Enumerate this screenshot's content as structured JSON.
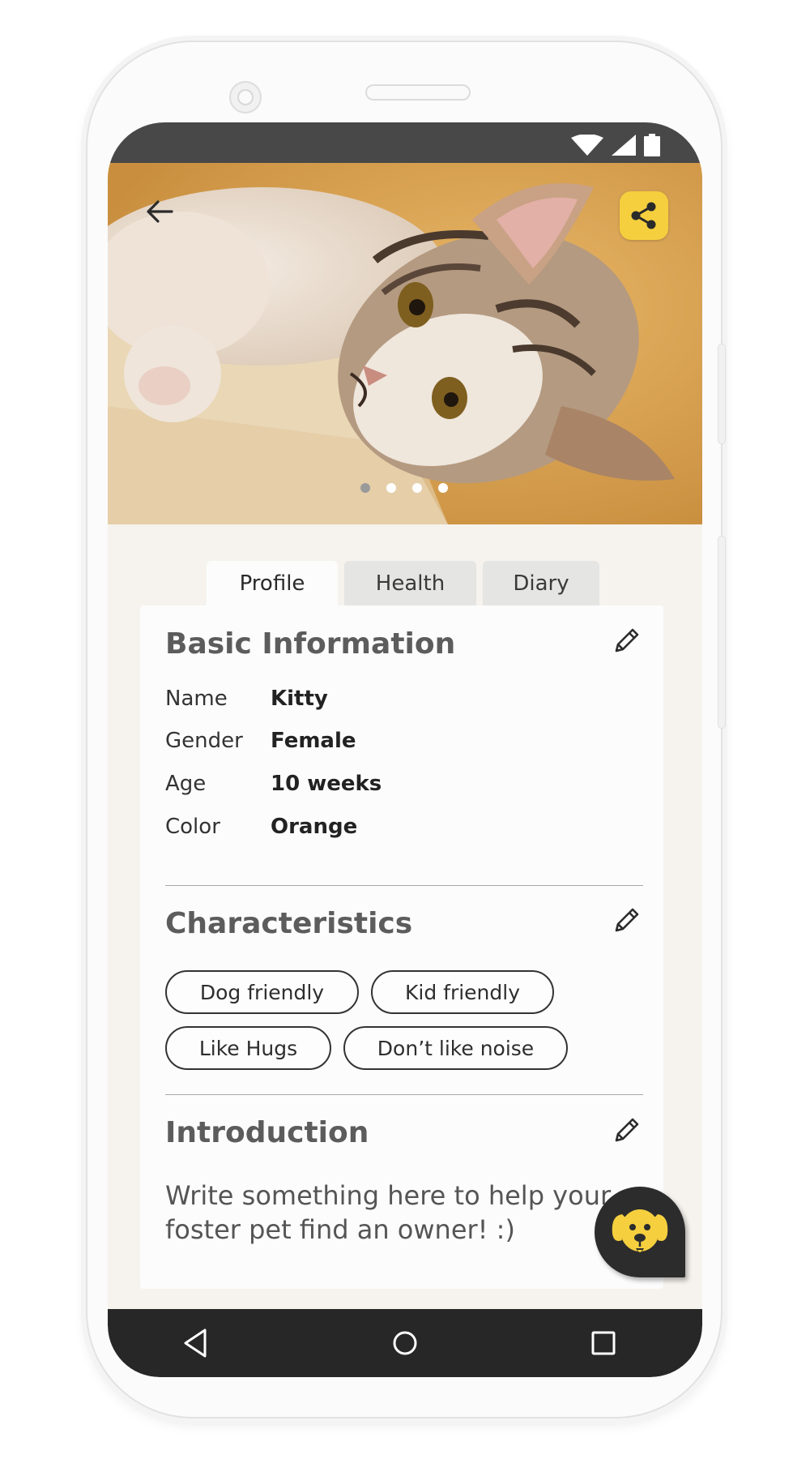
{
  "tabs": [
    {
      "label": "Profile",
      "active": true
    },
    {
      "label": "Health",
      "active": false
    },
    {
      "label": "Diary",
      "active": false
    }
  ],
  "basic_info": {
    "title": "Basic Information",
    "rows": [
      {
        "label": "Name",
        "value": "Kitty"
      },
      {
        "label": "Gender",
        "value": "Female"
      },
      {
        "label": "Age",
        "value": "10 weeks"
      },
      {
        "label": "Color",
        "value": "Orange"
      }
    ]
  },
  "characteristics": {
    "title": "Characteristics",
    "tags": [
      "Dog friendly",
      "Kid friendly",
      "Like Hugs",
      "Don’t like noise"
    ]
  },
  "introduction": {
    "title": "Introduction",
    "text": "Write something here to help your foster pet find an owner! :)"
  },
  "carousel": {
    "count": 4,
    "active_index": 0
  },
  "icons": {
    "back": "arrow-left-icon",
    "share": "share-icon",
    "edit": "pencil-icon",
    "fab": "dog-face-icon",
    "nav": [
      "back-triangle-icon",
      "home-circle-icon",
      "recents-square-icon"
    ]
  },
  "colors": {
    "accent": "#f5cf3e",
    "status_bar": "#484848",
    "nav_bar": "#272727",
    "background": "#f6f3ee",
    "card": "#fcfcfc",
    "text_dark": "#333333"
  }
}
